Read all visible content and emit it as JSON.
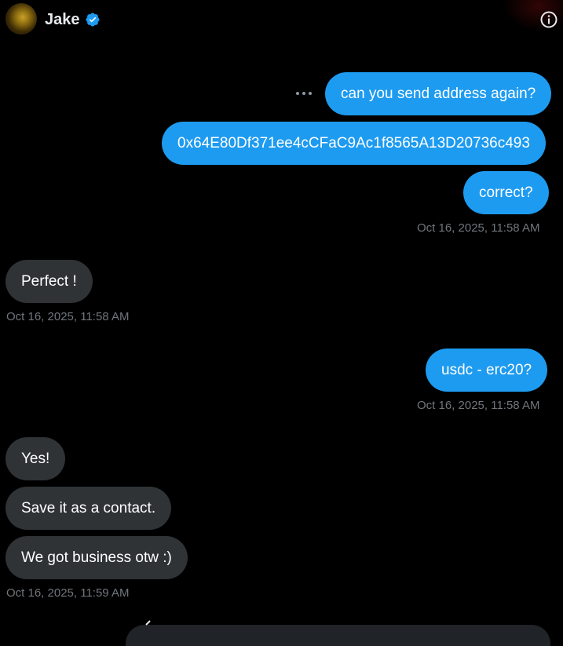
{
  "header": {
    "name": "Jake",
    "verified_color": "#1d9bf0",
    "avatar_icon": "avatar-gold-icon",
    "info_icon": "info-icon"
  },
  "messages": [
    {
      "side": "out",
      "text": "can you send address again?"
    },
    {
      "side": "out",
      "text": "0x64E80Df371ee4cCFaC9Ac1f8565A13D20736c493"
    },
    {
      "side": "out",
      "text": "correct?"
    },
    {
      "side": "in",
      "text": "Perfect !"
    },
    {
      "side": "out",
      "text": "usdc - erc20?"
    },
    {
      "side": "in",
      "text": "Yes!"
    },
    {
      "side": "in",
      "text": "Save it as a contact."
    },
    {
      "side": "in",
      "text": "We got business otw :)"
    }
  ],
  "timestamps": [
    "Oct 16, 2025, 11:58 AM",
    "Oct 16, 2025, 11:58 AM",
    "Oct 16, 2025, 11:58 AM",
    "Oct 16, 2025, 11:59 AM"
  ],
  "colors": {
    "background": "#000000",
    "outgoing_bubble": "#1d9bf0",
    "incoming_bubble": "#2f3336",
    "timestamp": "#71767b"
  }
}
